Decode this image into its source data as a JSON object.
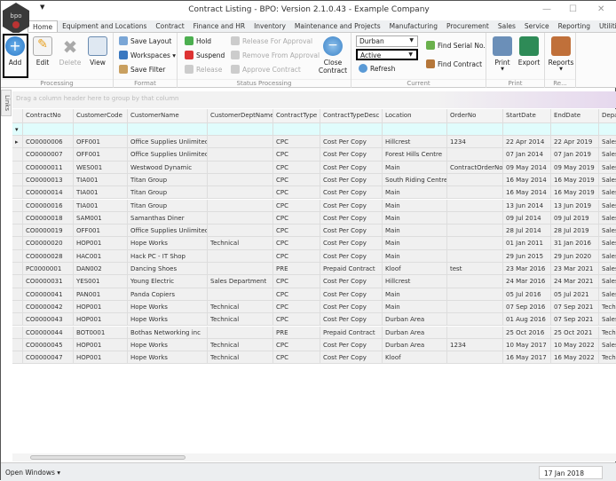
{
  "window": {
    "title": "Contract Listing - BPO: Version 2.1.0.43 - Example Company",
    "logo_text": "bpo",
    "minimize": "—",
    "maximize": "☐",
    "close": "✕"
  },
  "tabs": [
    "Home",
    "Equipment and Locations",
    "Contract",
    "Finance and HR",
    "Inventory",
    "Maintenance and Projects",
    "Manufacturing",
    "Procurement",
    "Sales",
    "Service",
    "Reporting",
    "Utilities"
  ],
  "ribbon": {
    "processing": {
      "label": "Processing",
      "add": "Add",
      "edit": "Edit",
      "delete": "Delete",
      "view": "View"
    },
    "format": {
      "label": "Format",
      "save_layout": "Save Layout",
      "workspaces": "Workspaces ▾",
      "save_filter": "Save Filter"
    },
    "status": {
      "label": "Status Processing",
      "hold": "Hold",
      "suspend": "Suspend",
      "release": "Release",
      "release_for_approval": "Release For Approval",
      "remove_from_approval": "Remove From Approval",
      "approve_contract": "Approve Contract",
      "close_contract": "Close Contract"
    },
    "current": {
      "label": "Current",
      "branch": "Durban",
      "status": "Active",
      "refresh": "Refresh",
      "find_serial": "Find Serial No.",
      "find_contract": "Find Contract"
    },
    "print": {
      "label": "Print",
      "print": "Print",
      "export": "Export"
    },
    "reports": {
      "label": "Re...",
      "reports": "Reports"
    }
  },
  "links_tab": "Links",
  "group_panel": "Drag a column header here to group by that column",
  "grid": {
    "columns": [
      "ContractNo",
      "CustomerCode",
      "CustomerName",
      "CustomerDeptName",
      "ContractType",
      "ContractTypeDesc",
      "Location",
      "OrderNo",
      "StartDate",
      "EndDate",
      "Depa"
    ],
    "rows": [
      [
        "CO0000006",
        "OFF001",
        "Office Supplies Unlimited",
        "",
        "CPC",
        "Cost Per Copy",
        "Hillcrest",
        "1234",
        "22 Apr 2014",
        "22 Apr 2019",
        "Sales"
      ],
      [
        "CO0000007",
        "OFF001",
        "Office Supplies Unlimited",
        "",
        "CPC",
        "Cost Per Copy",
        "Forest Hills Centre",
        "",
        "07 Jan 2014",
        "07 Jan 2019",
        "Sales"
      ],
      [
        "CO0000011",
        "WES001",
        "Westwood Dynamic",
        "",
        "CPC",
        "Cost Per Copy",
        "Main",
        "ContractOrderNo",
        "09 May 2014",
        "09 May 2019",
        "Sales"
      ],
      [
        "CO0000013",
        "TIA001",
        "Titan Group",
        "",
        "CPC",
        "Cost Per Copy",
        "South Riding Centre",
        "",
        "16 May 2014",
        "16 May 2019",
        "Sales"
      ],
      [
        "CO0000014",
        "TIA001",
        "Titan Group",
        "",
        "CPC",
        "Cost Per Copy",
        "Main",
        "",
        "16 May 2014",
        "16 May 2019",
        "Sales"
      ],
      [
        "CO0000016",
        "TIA001",
        "Titan Group",
        "",
        "CPC",
        "Cost Per Copy",
        "Main",
        "",
        "13 Jun 2014",
        "13 Jun 2019",
        "Sales"
      ],
      [
        "CO0000018",
        "SAM001",
        "Samanthas Diner",
        "",
        "CPC",
        "Cost Per Copy",
        "Main",
        "",
        "09 Jul 2014",
        "09 Jul 2019",
        "Sales"
      ],
      [
        "CO0000019",
        "OFF001",
        "Office Supplies Unlimited",
        "",
        "CPC",
        "Cost Per Copy",
        "Main",
        "",
        "28 Jul 2014",
        "28 Jul 2019",
        "Sales"
      ],
      [
        "CO0000020",
        "HOP001",
        "Hope Works",
        "Technical",
        "CPC",
        "Cost Per Copy",
        "Main",
        "",
        "01 Jan 2011",
        "31 Jan 2016",
        "Sales"
      ],
      [
        "CO0000028",
        "HAC001",
        "Hack PC - IT Shop",
        "",
        "CPC",
        "Cost Per Copy",
        "Main",
        "",
        "29 Jun 2015",
        "29 Jun 2020",
        "Sales"
      ],
      [
        "PC0000001",
        "DAN002",
        "Dancing Shoes",
        "",
        "PRE",
        "Prepaid Contract",
        "Kloof",
        "test",
        "23 Mar 2016",
        "23 Mar 2021",
        "Sales"
      ],
      [
        "CO0000031",
        "YES001",
        "Young Electric",
        "Sales Department",
        "CPC",
        "Cost Per Copy",
        "Hillcrest",
        "",
        "24 Mar 2016",
        "24 Mar 2021",
        "Sales"
      ],
      [
        "CO0000041",
        "PAN001",
        "Panda Copiers",
        "",
        "CPC",
        "Cost Per Copy",
        "Main",
        "",
        "05 Jul 2016",
        "05 Jul 2021",
        "Sales"
      ],
      [
        "CO0000042",
        "HOP001",
        "Hope Works",
        "Technical",
        "CPC",
        "Cost Per Copy",
        "Main",
        "",
        "07 Sep 2016",
        "07 Sep 2021",
        "Tech"
      ],
      [
        "CO0000043",
        "HOP001",
        "Hope Works",
        "Technical",
        "CPC",
        "Cost Per Copy",
        "Durban Area",
        "",
        "01 Aug 2016",
        "07 Sep 2021",
        "Sales"
      ],
      [
        "CO0000044",
        "BOT0001",
        "Bothas Networking inc",
        "",
        "PRE",
        "Prepaid Contract",
        "Durban Area",
        "",
        "25 Oct 2016",
        "25 Oct 2021",
        "Tech"
      ],
      [
        "CO0000045",
        "HOP001",
        "Hope Works",
        "Technical",
        "CPC",
        "Cost Per Copy",
        "Durban Area",
        "1234",
        "10 May 2017",
        "10 May 2022",
        "Sales"
      ],
      [
        "CO0000047",
        "HOP001",
        "Hope Works",
        "Technical",
        "CPC",
        "Cost Per Copy",
        "Kloof",
        "",
        "16 May 2017",
        "16 May 2022",
        "Tech"
      ]
    ]
  },
  "statusbar": {
    "open_windows": "Open Windows ▾",
    "date": "17 Jan 2018"
  }
}
